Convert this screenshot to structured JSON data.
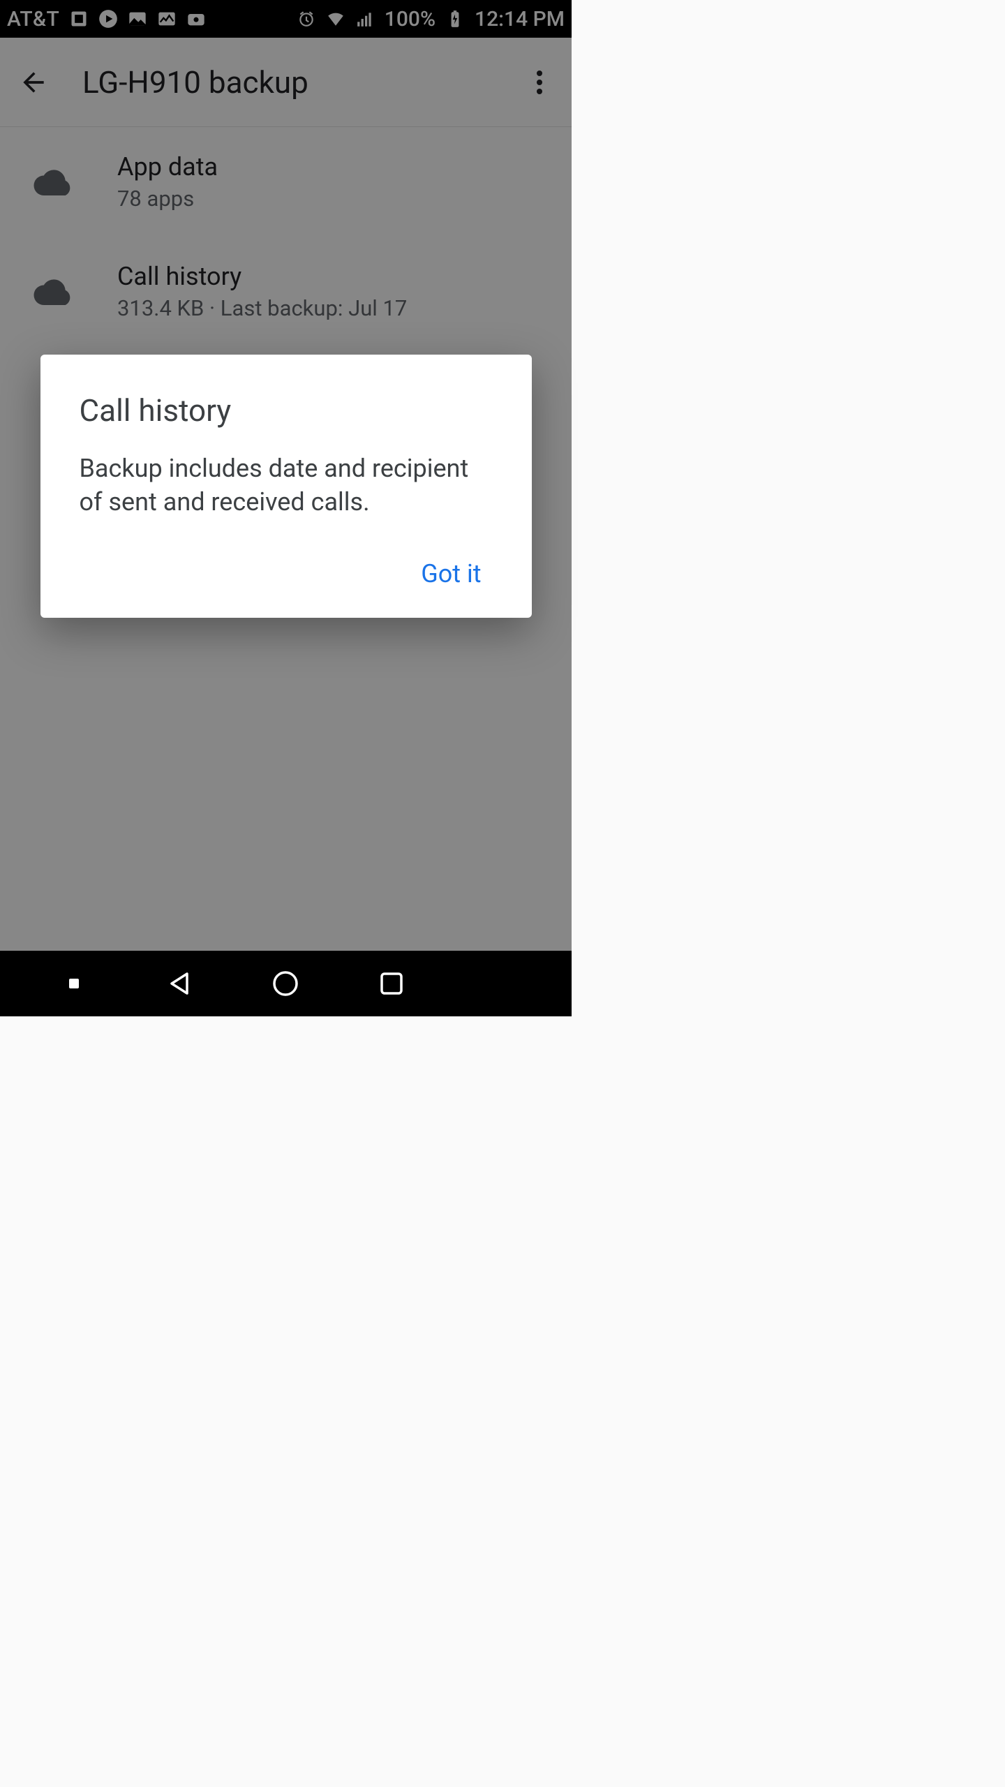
{
  "status": {
    "carrier": "AT&T",
    "battery_pct": "100%",
    "time": "12:14 PM"
  },
  "appbar": {
    "title": "LG-H910 backup"
  },
  "rows": [
    {
      "title": "App data",
      "sub": "78 apps"
    },
    {
      "title": "Call history",
      "sub": "313.4 KB · Last backup: Jul 17"
    }
  ],
  "dialog": {
    "title": "Call history",
    "body": "Backup includes date and recipient of sent and received calls.",
    "confirm": "Got it"
  },
  "colors": {
    "accent": "#1a73e8"
  }
}
